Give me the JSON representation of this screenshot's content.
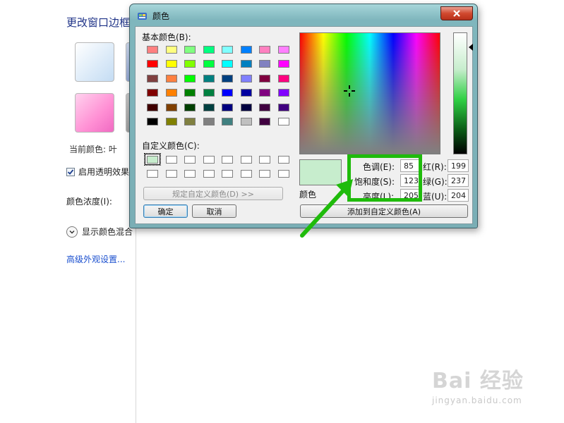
{
  "background_window": {
    "title": "更改窗口边框",
    "current_color_label": "当前颜色: 叶",
    "transparency_label": "启用透明效果(",
    "intensity_label": "颜色浓度(I):",
    "mixer_label": "显示颜色混合",
    "advanced_link": "高级外观设置..."
  },
  "color_dialog": {
    "title": "颜色",
    "basic_colors_label": "基本颜色(B):",
    "custom_colors_label": "自定义颜色(C):",
    "define_custom_button": "规定自定义颜色(D) >>",
    "ok_button": "确定",
    "cancel_button": "取消",
    "color_solid_label": "颜色",
    "hue_label": "色调(E):",
    "hue_value": "85",
    "sat_label": "饱和度(S):",
    "sat_value": "123",
    "lum_label": "亮度(L):",
    "lum_value": "205",
    "red_label": "红(R):",
    "red_value": "199",
    "green_label": "绿(G):",
    "green_value": "237",
    "blue_label": "蓝(U):",
    "blue_value": "204",
    "add_custom_button": "添加到自定义颜色(A)",
    "current_color": "#c7edcd",
    "basic_colors": [
      "#ff8080",
      "#ffff80",
      "#80ff80",
      "#00ff80",
      "#80ffff",
      "#0080ff",
      "#ff80c0",
      "#ff80ff",
      "#ff0000",
      "#ffff00",
      "#80ff00",
      "#00ff40",
      "#00ffff",
      "#0080c0",
      "#8080c0",
      "#ff00ff",
      "#804040",
      "#ff8040",
      "#00ff00",
      "#008080",
      "#004080",
      "#8080ff",
      "#800040",
      "#ff0080",
      "#800000",
      "#ff8000",
      "#008000",
      "#008040",
      "#0000ff",
      "#0000a0",
      "#800080",
      "#8000ff",
      "#400000",
      "#804000",
      "#004000",
      "#004040",
      "#000080",
      "#000040",
      "#400040",
      "#400080",
      "#000000",
      "#808000",
      "#808040",
      "#808080",
      "#408080",
      "#c0c0c0",
      "#400040",
      "#ffffff"
    ],
    "custom_colors": [
      "#c7edcd",
      "#ffffff",
      "#ffffff",
      "#ffffff",
      "#ffffff",
      "#ffffff",
      "#ffffff",
      "#ffffff",
      "#ffffff",
      "#ffffff",
      "#ffffff",
      "#ffffff",
      "#ffffff",
      "#ffffff",
      "#ffffff",
      "#ffffff"
    ]
  },
  "annotation": {
    "highlight_color": "#1fbb0b"
  },
  "watermark": {
    "brand": "Bai 经验",
    "url": "jingyan.baidu.com"
  }
}
